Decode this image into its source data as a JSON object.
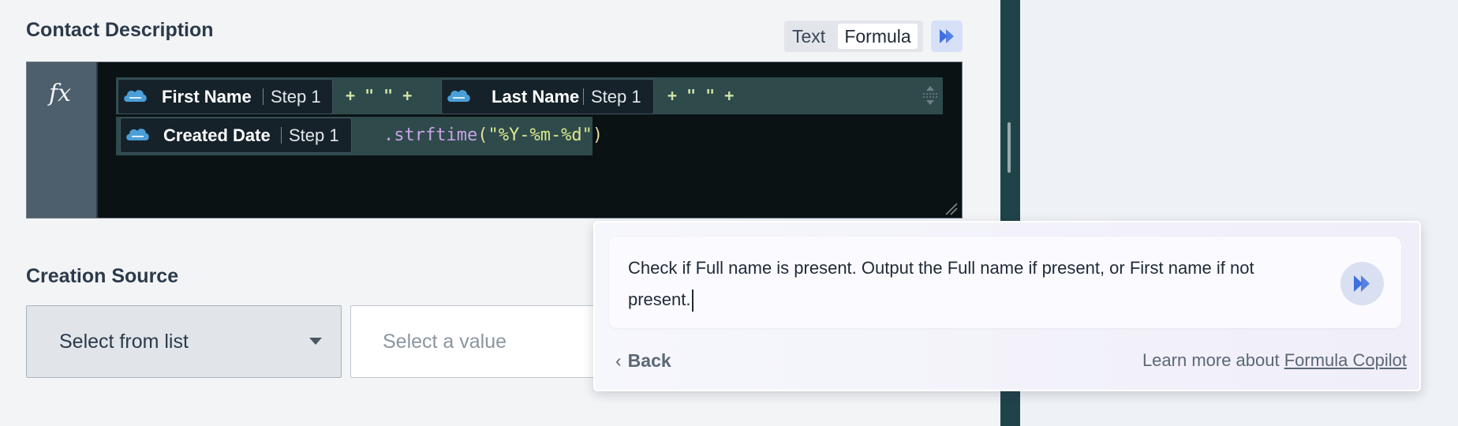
{
  "contact_description": {
    "label": "Contact Description",
    "mode_toggle": {
      "text": "Text",
      "formula": "Formula"
    },
    "editor": {
      "fx_symbol": "fx",
      "chips": [
        {
          "field": "First Name",
          "step": "Step 1",
          "icon": "salesforce-icon"
        },
        {
          "field": "Last Name",
          "step": "Step 1",
          "icon": "salesforce-icon"
        },
        {
          "field": "Created Date",
          "step": "Step 1",
          "icon": "salesforce-icon"
        }
      ],
      "operators": [
        "+ \" \" +",
        "+ \" \" +"
      ],
      "code_method": ".strftime",
      "code_open": "(",
      "code_string": "\"%Y-%m-%d\"",
      "code_close": ")"
    }
  },
  "creation_source": {
    "label": "Creation Source",
    "select_label": "Select from list",
    "value_placeholder": "Select a value"
  },
  "copilot": {
    "prompt": "Check if Full name is present. Output the Full name if present, or First name if not present.",
    "back_label": "Back",
    "learn_prefix": "Learn more about ",
    "learn_link": "Formula Copilot"
  },
  "colors": {
    "accent": "#3f6fe0",
    "divider": "#20434a",
    "editor_bg": "#0a1214",
    "salesforce": "#4a9fd8"
  }
}
